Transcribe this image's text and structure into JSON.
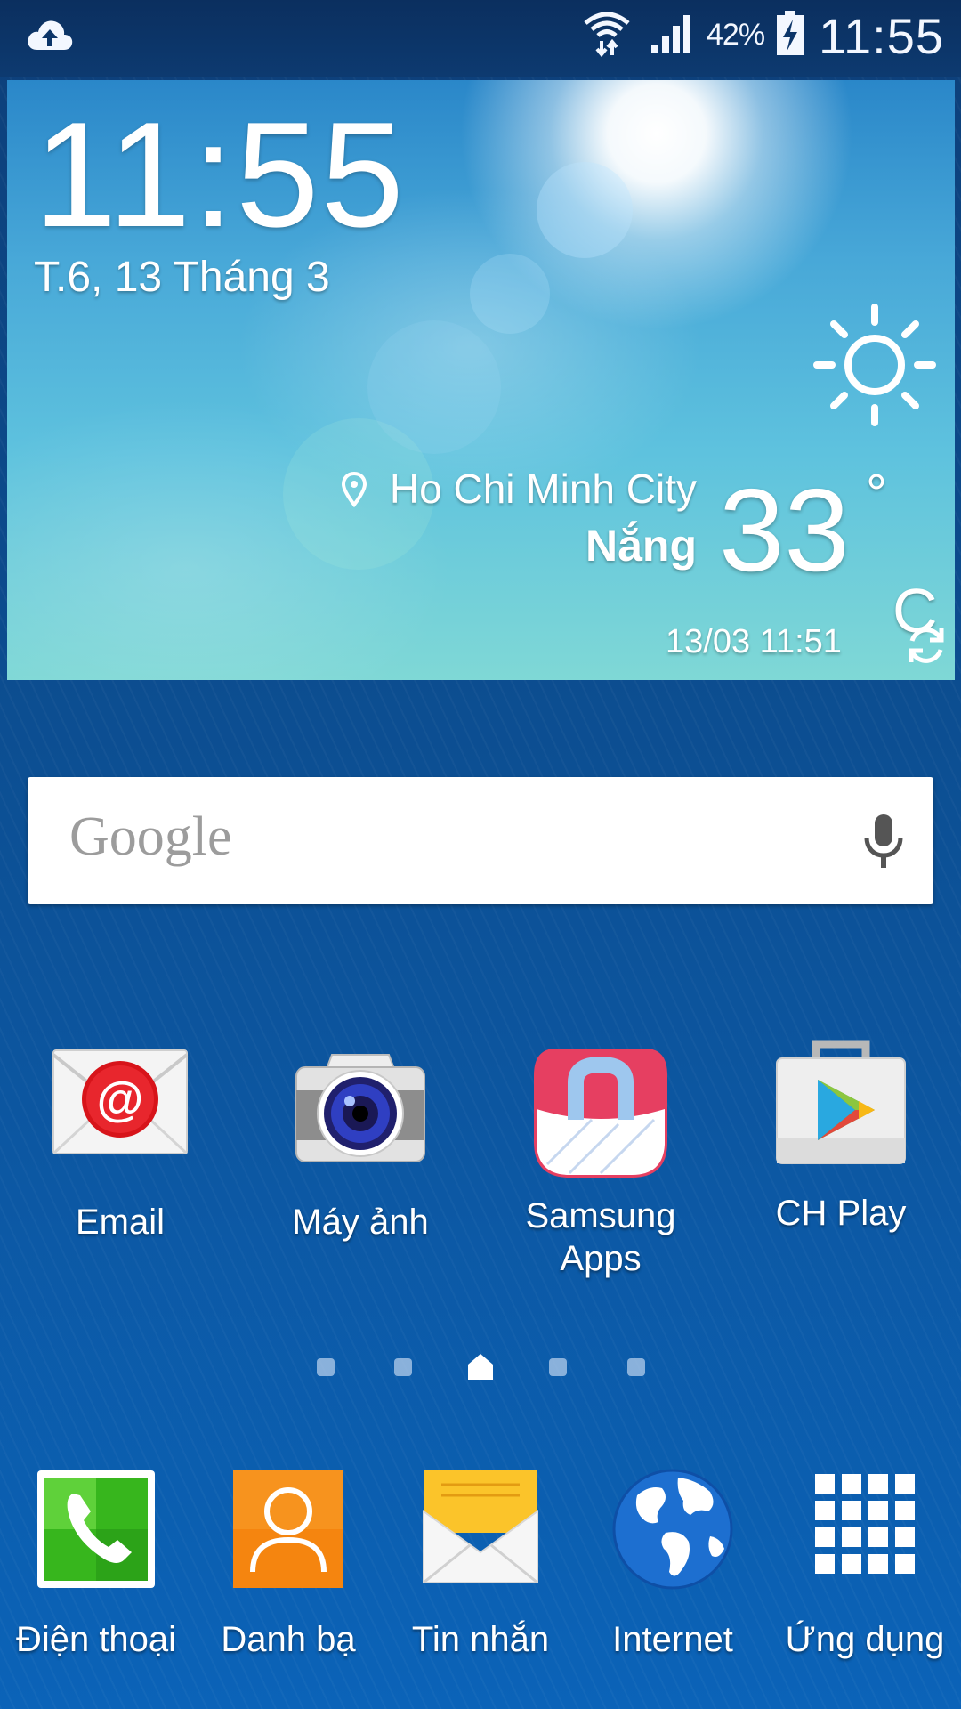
{
  "status_bar": {
    "battery_percent": "42%",
    "time": "11:55",
    "icons": [
      "cloud-upload-icon",
      "wifi-icon",
      "cell-signal-icon",
      "battery-charging-icon"
    ]
  },
  "weather_widget": {
    "time": "11:55",
    "date": "T.6, 13 Tháng 3",
    "city": "Ho Chi Minh City",
    "condition": "Nắng",
    "temperature": "33",
    "degree_symbol": "°",
    "unit": "C",
    "updated": "13/03 11:51",
    "icons": [
      "sun-icon",
      "location-pin-icon",
      "refresh-icon"
    ]
  },
  "search_bar": {
    "logo_text": "Google",
    "icon": "microphone-icon"
  },
  "apps": [
    {
      "label": "Email",
      "icon": "email-icon"
    },
    {
      "label": "Máy ảnh",
      "icon": "camera-icon"
    },
    {
      "label": "Samsung\nApps",
      "icon": "samsung-apps-icon"
    },
    {
      "label": "CH Play",
      "icon": "play-store-icon"
    }
  ],
  "page_indicator": {
    "total_pages": 5,
    "current_page": 3,
    "current_is_home": true
  },
  "dock": [
    {
      "label": "Điện thoại",
      "icon": "phone-icon"
    },
    {
      "label": "Danh bạ",
      "icon": "contacts-icon"
    },
    {
      "label": "Tin nhắn",
      "icon": "messages-icon"
    },
    {
      "label": "Internet",
      "icon": "internet-globe-icon"
    },
    {
      "label": "Ứng dụng",
      "icon": "app-drawer-icon"
    }
  ],
  "colors": {
    "wallpaper": "#0c4f93",
    "status_bar": "#0b2f5f",
    "widget_sky": "#48a8d8",
    "email_red": "#d7141a",
    "contacts_orange": "#f5850f",
    "phone_green": "#37b61d"
  }
}
